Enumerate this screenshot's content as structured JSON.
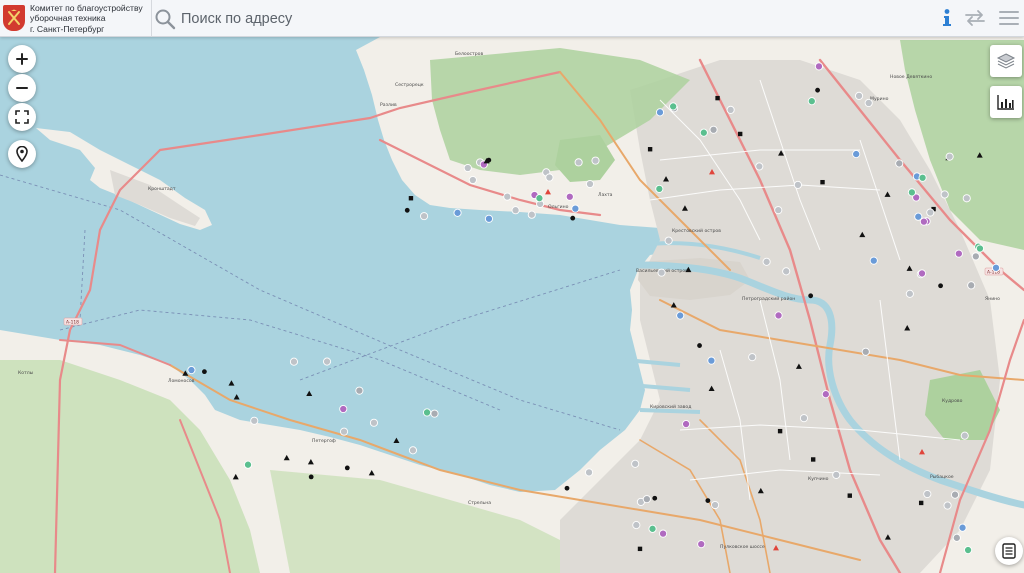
{
  "header": {
    "org_line1": "Комитет по благоустройству",
    "org_line2": "уборочная техника",
    "org_line3": "г. Санкт-Петербург",
    "search_placeholder": "Поиск по адресу"
  },
  "icons": {
    "emblem": "spb-coat-of-arms-icon",
    "search": "search-icon",
    "info": "info-icon",
    "swap": "swap-arrows-icon",
    "menu": "menu-icon",
    "zoom_in": "plus-icon",
    "zoom_out": "minus-icon",
    "fullscreen": "fullscreen-icon",
    "locate": "location-pin-icon",
    "layers": "layers-icon",
    "chart": "bar-chart-icon",
    "list": "list-icon"
  },
  "colors": {
    "water": "#aad3df",
    "land": "#f2efe9",
    "forest": "#add19e",
    "urban": "#dedbd6",
    "brand_red": "#d23a2f",
    "info_blue": "#2d7fd3",
    "major_road": "#e8a86a",
    "motorway": "#e88a8a"
  },
  "map_labels": {
    "kronshtadt": "Кронштадт",
    "lomonosov": "Ломоносов",
    "petergof": "Петергоф",
    "strelna": "Стрельна",
    "kupchino": "Купчино",
    "kudrovo": "Кудрово",
    "murino": "Мурино",
    "sestroretsk": "Сестрорецк",
    "lakhta": "Лахта",
    "vasilyevsky": "Васильевский остров",
    "petrogradsky": "Петроградский район",
    "krestovsky": "Крестовский остров",
    "kirovsky": "Кировский завод",
    "kolpino_road": "Пулковское шоссе",
    "a118": "А-118",
    "a118_east": "А-118",
    "rybatskoe": "Рыбацкое",
    "novoe_devyatkino": "Новое Девяткино",
    "yanino": "Янино",
    "razliv": "Разлив",
    "beloostrov": "Белоостров",
    "olgino": "Ольгино",
    "kotly": "Котлы"
  },
  "stats": {
    "vehicles_marked": 148
  }
}
